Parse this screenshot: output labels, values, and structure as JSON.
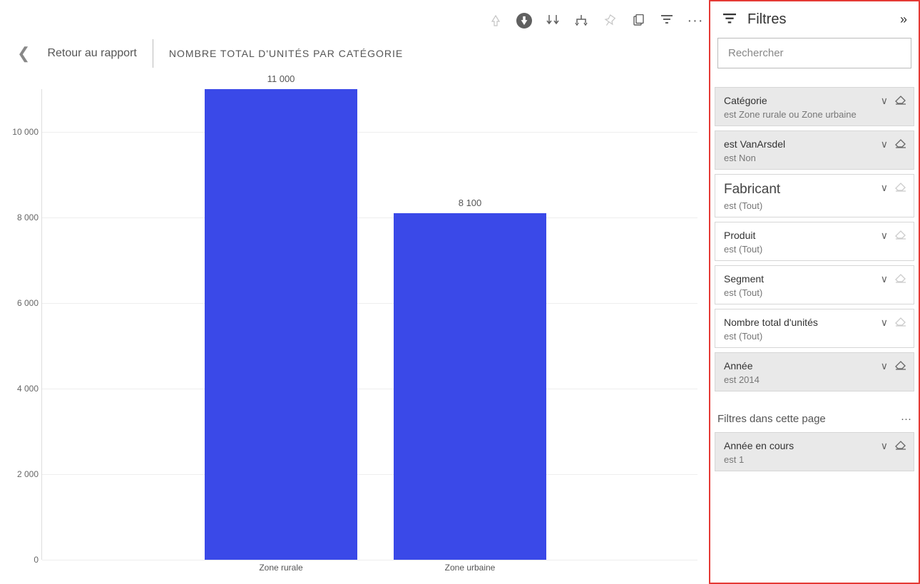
{
  "toolbar": {
    "drillup": "↑",
    "drilldown": "↓",
    "expand_levels": "expand",
    "nexthier": "nexthier"
  },
  "breadcrumb": {
    "back": "Retour au rapport",
    "title": "NOMBRE TOTAL D'UNITÉS PAR CATÉGORIE"
  },
  "chart_data": {
    "type": "bar",
    "title": "NOMBRE TOTAL D'UNITÉS PAR CATÉGORIE",
    "categories": [
      "Zone rurale",
      "Zone urbaine"
    ],
    "values": [
      11000,
      8100
    ],
    "value_labels": [
      "11 000",
      "8 100"
    ],
    "ylim": [
      0,
      11000
    ],
    "yticks": [
      0,
      2000,
      4000,
      6000,
      8000,
      10000
    ],
    "ytick_labels": [
      "0",
      "2 000",
      "4 000",
      "6 000",
      "8 000",
      "10 000"
    ],
    "bar_color": "#3a49e8"
  },
  "panel": {
    "title": "Filtres",
    "search_placeholder": "Rechercher",
    "page_filters_header": "Filtres dans cette page",
    "filters": [
      {
        "name": "Catégorie",
        "value": "est Zone rurale ou Zone urbaine",
        "applied": true,
        "erasable": true
      },
      {
        "name": "est VanArsdel",
        "value": "est Non",
        "applied": true,
        "erasable": true
      },
      {
        "name": "Fabricant",
        "value": "est (Tout)",
        "applied": false,
        "big": true,
        "erasable": false
      },
      {
        "name": "Produit",
        "value": "est (Tout)",
        "applied": false,
        "erasable": false
      },
      {
        "name": "Segment",
        "value": "est (Tout)",
        "applied": false,
        "erasable": false
      },
      {
        "name": "Nombre total d'unités",
        "value": "est (Tout)",
        "applied": false,
        "erasable": false
      },
      {
        "name": "Année",
        "value": "est 2014",
        "applied": true,
        "erasable": true
      }
    ],
    "page_filters": [
      {
        "name": "Année en cours",
        "value": "est 1",
        "applied": true,
        "erasable": true
      }
    ]
  }
}
